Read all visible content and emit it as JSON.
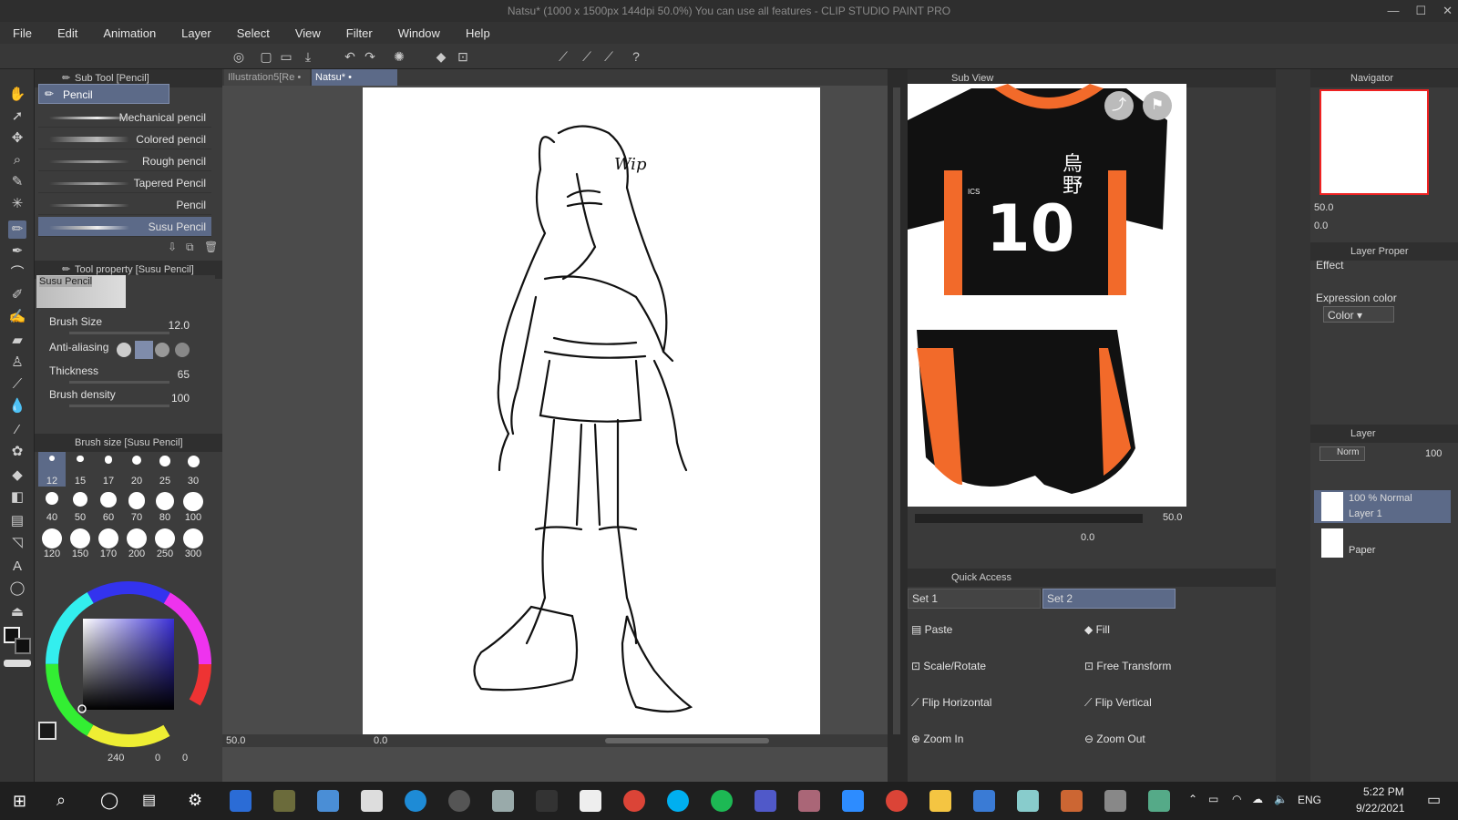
{
  "window": {
    "title": "Natsu* (1000 x 1500px 144dpi 50.0%)  You can use all features - CLIP STUDIO PAINT PRO"
  },
  "menu": [
    "File",
    "Edit",
    "Animation",
    "Layer",
    "Select",
    "View",
    "Filter",
    "Window",
    "Help"
  ],
  "subtool": {
    "header": "Sub Tool [Pencil]",
    "group": "Pencil",
    "brushes": [
      "Mechanical pencil",
      "Colored pencil",
      "Rough pencil",
      "Tapered Pencil",
      "Pencil",
      "Susu Pencil"
    ],
    "selected": "Susu Pencil"
  },
  "toolprop": {
    "header": "Tool property [Susu Pencil]",
    "preview_label": "Susu Pencil",
    "brush_size_label": "Brush Size",
    "brush_size": "12.0",
    "anti_aliasing_label": "Anti-aliasing",
    "thickness_label": "Thickness",
    "thickness": "65",
    "density_label": "Brush density",
    "density": "100"
  },
  "brushsize": {
    "header": "Brush size [Susu Pencil]",
    "sizes": [
      "12",
      "15",
      "17",
      "20",
      "25",
      "30",
      "40",
      "50",
      "60",
      "70",
      "80",
      "100",
      "120",
      "150",
      "170",
      "200",
      "250",
      "300"
    ]
  },
  "color": {
    "main": "#1a1a1a",
    "sub": "#ffffff",
    "hue_square": "#3a2fd6",
    "readout_a": "240",
    "readout_b": "0",
    "readout_c": "0"
  },
  "canvas": {
    "tabs": [
      "Illustration5[Re",
      "Natsu*"
    ],
    "wip_text": "Wip",
    "zoom": "50.0",
    "rotation": "0.0"
  },
  "subview": {
    "header": "Sub View",
    "jersey_number": "10",
    "jersey_text": "烏\n野",
    "jersey_badge": "ICS",
    "zoom": "50.0",
    "rotation": "0.0"
  },
  "quick": {
    "header": "Quick Access",
    "sets": [
      "Set 1",
      "Set 2"
    ],
    "actions": [
      "Paste",
      "Fill",
      "Scale/Rotate",
      "Free Transform",
      "Flip Horizontal",
      "Flip Vertical",
      "Zoom In",
      "Zoom Out"
    ]
  },
  "navigator": {
    "header": "Navigator",
    "zoom": "50.0",
    "rotation": "0.0"
  },
  "layerprop": {
    "header": "Layer Proper",
    "effect_label": "Effect",
    "expression_label": "Expression color",
    "expression_value": "Color"
  },
  "layers": {
    "header": "Layer",
    "blend": "Norm",
    "opacity": "100",
    "items": [
      {
        "top": "100 % Normal",
        "name": "Layer 1"
      },
      {
        "top": "",
        "name": "Paper"
      }
    ]
  },
  "taskbar": {
    "lang": "ENG",
    "time": "5:22 PM",
    "date": "9/22/2021"
  }
}
